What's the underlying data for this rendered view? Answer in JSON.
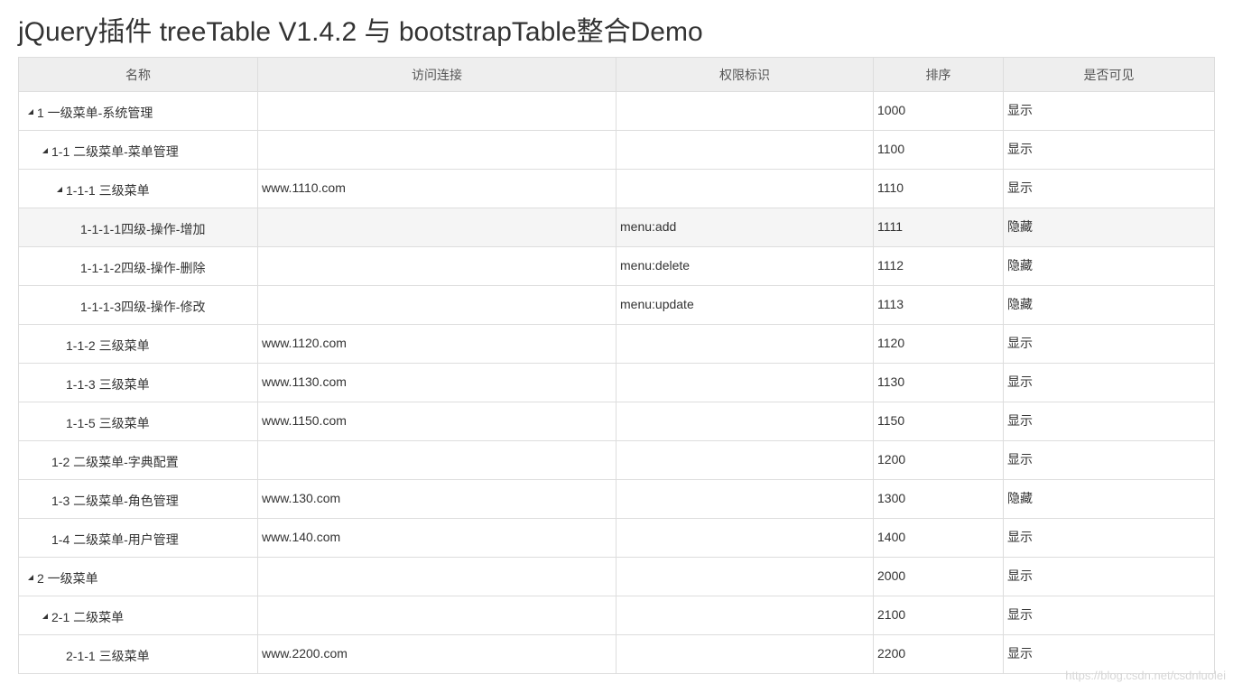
{
  "page_title": "jQuery插件 treeTable V1.4.2 与 bootstrapTable整合Demo",
  "columns": [
    "名称",
    "访问连接",
    "权限标识",
    "排序",
    "是否可见"
  ],
  "rows": [
    {
      "name": "1 一级菜单-系统管理",
      "url": "",
      "perm": "",
      "sort": "1000",
      "visible": "显示"
    },
    {
      "name": "1-1 二级菜单-菜单管理",
      "url": "",
      "perm": "",
      "sort": "1100",
      "visible": "显示"
    },
    {
      "name": "1-1-1 三级菜单",
      "url": "www.1110.com",
      "perm": "",
      "sort": "1110",
      "visible": "显示"
    },
    {
      "name": "1-1-1-1四级-操作-增加",
      "url": "",
      "perm": "menu:add",
      "sort": "1111",
      "visible": "隐藏"
    },
    {
      "name": "1-1-1-2四级-操作-删除",
      "url": "",
      "perm": "menu:delete",
      "sort": "1112",
      "visible": "隐藏"
    },
    {
      "name": "1-1-1-3四级-操作-修改",
      "url": "",
      "perm": "menu:update",
      "sort": "1113",
      "visible": "隐藏"
    },
    {
      "name": "1-1-2 三级菜单",
      "url": "www.1120.com",
      "perm": "",
      "sort": "1120",
      "visible": "显示"
    },
    {
      "name": "1-1-3 三级菜单",
      "url": "www.1130.com",
      "perm": "",
      "sort": "1130",
      "visible": "显示"
    },
    {
      "name": "1-1-5 三级菜单",
      "url": "www.1150.com",
      "perm": "",
      "sort": "1150",
      "visible": "显示"
    },
    {
      "name": "1-2 二级菜单-字典配置",
      "url": "",
      "perm": "",
      "sort": "1200",
      "visible": "显示"
    },
    {
      "name": "1-3 二级菜单-角色管理",
      "url": "www.130.com",
      "perm": "",
      "sort": "1300",
      "visible": "隐藏"
    },
    {
      "name": "1-4 二级菜单-用户管理",
      "url": "www.140.com",
      "perm": "",
      "sort": "1400",
      "visible": "显示"
    },
    {
      "name": "2 一级菜单",
      "url": "",
      "perm": "",
      "sort": "2000",
      "visible": "显示"
    },
    {
      "name": "2-1 二级菜单",
      "url": "",
      "perm": "",
      "sort": "2100",
      "visible": "显示"
    },
    {
      "name": "2-1-1 三级菜单",
      "url": "www.2200.com",
      "perm": "",
      "sort": "2200",
      "visible": "显示"
    }
  ],
  "watermark": "https://blog.csdn.net/csdnluolei"
}
